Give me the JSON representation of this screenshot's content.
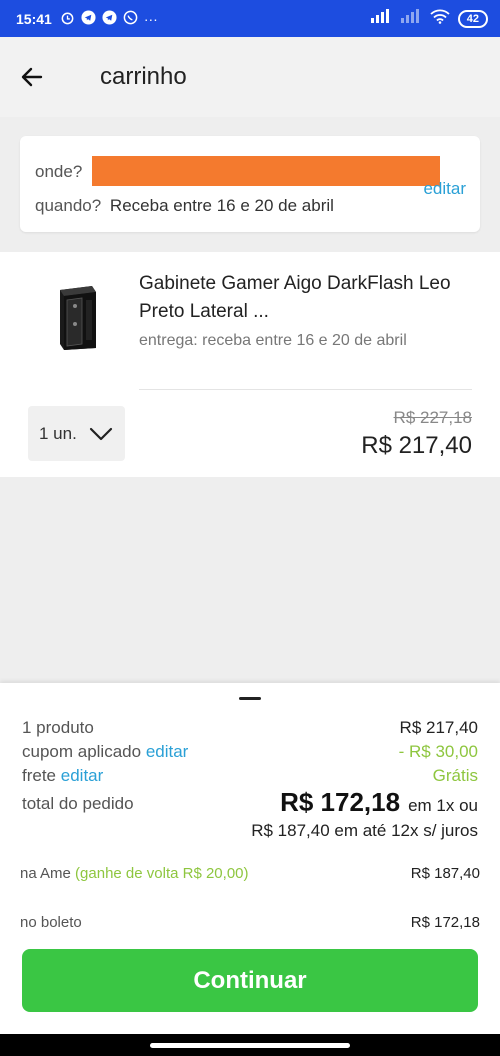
{
  "status_bar": {
    "time": "15:41",
    "battery": "42"
  },
  "header": {
    "title": "carrinho"
  },
  "delivery": {
    "where_label": "onde?",
    "when_label": "quando?",
    "when_value": "Receba entre 16 e 20 de abril",
    "edit_label": "editar"
  },
  "product": {
    "title": "Gabinete Gamer Aigo DarkFlash Leo Preto Lateral ...",
    "delivery_text": "entrega: receba entre 16 e 20 de abril",
    "quantity": "1 un.",
    "price_old": "R$ 227,18",
    "price_new": "R$ 217,40"
  },
  "summary": {
    "products_label": "1 produto",
    "products_value": "R$ 217,40",
    "coupon_label": "cupom aplicado",
    "coupon_edit": "editar",
    "coupon_value": "- R$ 30,00",
    "shipping_label": "frete",
    "shipping_edit": "editar",
    "shipping_value": "Grátis",
    "total_label": "total do pedido",
    "total_value": "R$ 172,18",
    "total_suffix": "em 1x ou",
    "installments": "R$ 187,40 em até 12x s/ juros",
    "ame_label": "na Ame",
    "ame_bonus": "(ganhe de volta R$ 20,00)",
    "ame_value": "R$ 187,40",
    "boleto_label": "no boleto",
    "boleto_value": "R$ 172,18",
    "continue_label": "Continuar"
  },
  "colors": {
    "status_bar": "#1d4de0",
    "link": "#2aa0d6",
    "green": "#8ec63f",
    "button": "#3ac644",
    "redaction": "#f47a2e"
  }
}
